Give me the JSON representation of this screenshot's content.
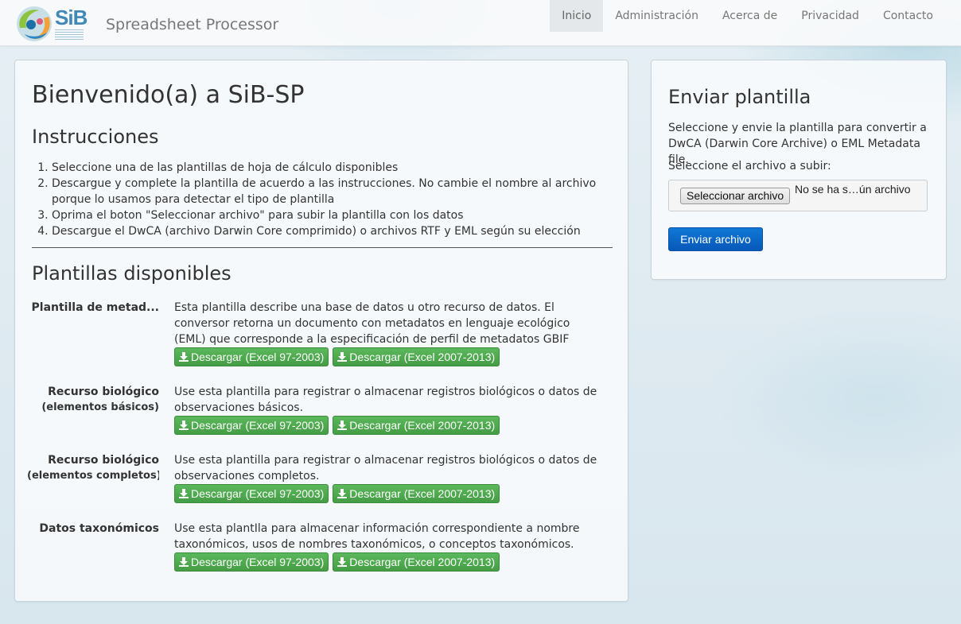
{
  "brand": {
    "logo_text": "SiB",
    "app_title": "Spreadsheet Processor"
  },
  "nav": {
    "items": [
      {
        "label": "Inicio",
        "active": true
      },
      {
        "label": "Administración"
      },
      {
        "label": "Acerca de"
      },
      {
        "label": "Privacidad"
      },
      {
        "label": "Contacto"
      }
    ]
  },
  "main": {
    "heading": "Bienvenido(a) a SiB-SP",
    "instructions_heading": "Instrucciones",
    "steps": [
      "Seleccione una de las plantillas de hoja de cálculo disponibles",
      "Descargue y complete la plantilla de acuerdo a las instrucciones. No cambie el nombre al archivo porque lo usamos para detectar el tipo de plantilla",
      "Oprima el boton \"Seleccionar archivo\" para subir la plantilla con los datos",
      "Descargue el DwCA (archivo Darwin Core comprimido) o archivos RTF y EML según su elección"
    ],
    "templates_heading": "Plantillas disponibles",
    "templates": [
      {
        "label": "Plantilla de metad...",
        "sublabel": "",
        "description": "Esta plantilla describe una base de datos u otro recurso de datos. El conversor retorna un documento con metadatos en lenguaje ecológico (EML) que corresponde a la especificación de perfil de metadatos GBIF (GMP)",
        "btn_xls": "Descargar (Excel 97-2003)",
        "btn_xlsx": "Descargar (Excel 2007-2013)"
      },
      {
        "label": "Recurso biológico",
        "sublabel": "(elementos básicos)",
        "description": "Use esta plantilla para registrar o almacenar registros biológicos o datos de observaciones básicos.",
        "btn_xls": "Descargar (Excel 97-2003)",
        "btn_xlsx": "Descargar (Excel 2007-2013)"
      },
      {
        "label": "Recurso biológico",
        "sublabel": "(elementos completos)",
        "description": "Use esta plantilla para registrar o almacenar registros biológicos o datos de observaciones completos.",
        "btn_xls": "Descargar (Excel 97-2003)",
        "btn_xlsx": "Descargar (Excel 2007-2013)"
      },
      {
        "label": "Datos taxonómicos",
        "sublabel": "",
        "description": "Use esta plantIla para almacenar información correspondiente a nombre taxonómicos, usos de nombres taxonómicos, o conceptos taxonómicos.",
        "btn_xls": "Descargar (Excel 97-2003)",
        "btn_xlsx": "Descargar (Excel 2007-2013)"
      }
    ]
  },
  "sidebar": {
    "title": "Enviar plantilla",
    "text": "Seleccione y envie la plantilla para convertir a DwCA (Darwin Core Archive) o EML Metadata file.",
    "file_label": "Seleccione el archivo a subir:",
    "file_button": "Seleccionar archivo",
    "file_status": "No se ha s…ún archivo",
    "submit": "Enviar archivo"
  },
  "colors": {
    "download_button": "#5cb85c",
    "submit_button": "#0f78d6",
    "brand_text": "#3f88b8"
  }
}
